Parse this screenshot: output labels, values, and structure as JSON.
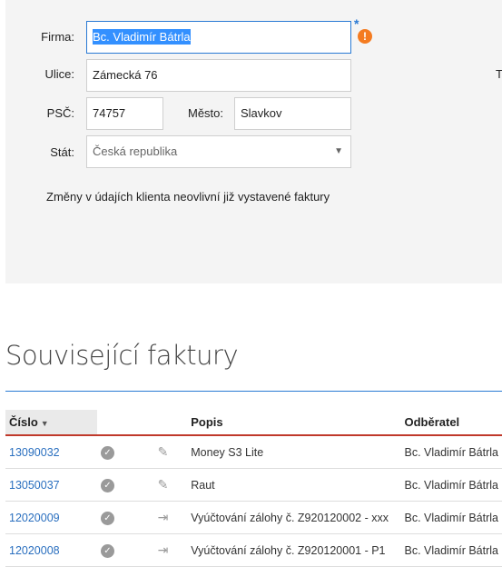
{
  "form": {
    "firma_label": "Firma:",
    "firma_value": "Bc. Vladimír Bátrla",
    "ulice_label": "Ulice:",
    "ulice_value": "Zámecká 76",
    "psc_label": "PSČ:",
    "psc_value": "74757",
    "mesto_label": "Město:",
    "mesto_value": "Slavkov",
    "stat_label": "Stát:",
    "stat_value": "Česká republika",
    "required_mark": "*",
    "warning_symbol": "!",
    "side_text": "T",
    "note": "Změny v údajích klienta neovlivní již vystavené faktury"
  },
  "invoices": {
    "title": "Související faktury",
    "columns": {
      "cislo": "Číslo",
      "popis": "Popis",
      "odberatel": "Odběratel"
    },
    "sort_indicator": "▼",
    "rows": [
      {
        "cislo": "13090032",
        "popis": "Money S3 Lite",
        "odberatel": "Bc. Vladimír Bátrla",
        "icon": "edit-icon"
      },
      {
        "cislo": "13050037",
        "popis": "Raut",
        "odberatel": "Bc. Vladimír Bátrla",
        "icon": "edit-icon"
      },
      {
        "cislo": "12020009",
        "popis": "Vyúčtování zálohy č. Z920120002 - xxx",
        "odberatel": "Bc. Vladimír Bátrla",
        "icon": "export-icon"
      },
      {
        "cislo": "12020008",
        "popis": "Vyúčtování zálohy č. Z920120001 - P1",
        "odberatel": "Bc. Vladimír Bátrla",
        "icon": "export-icon"
      }
    ]
  },
  "colors": {
    "accent": "#2a7ad4",
    "warning": "#f47b20",
    "header_underline": "#c0392b"
  }
}
